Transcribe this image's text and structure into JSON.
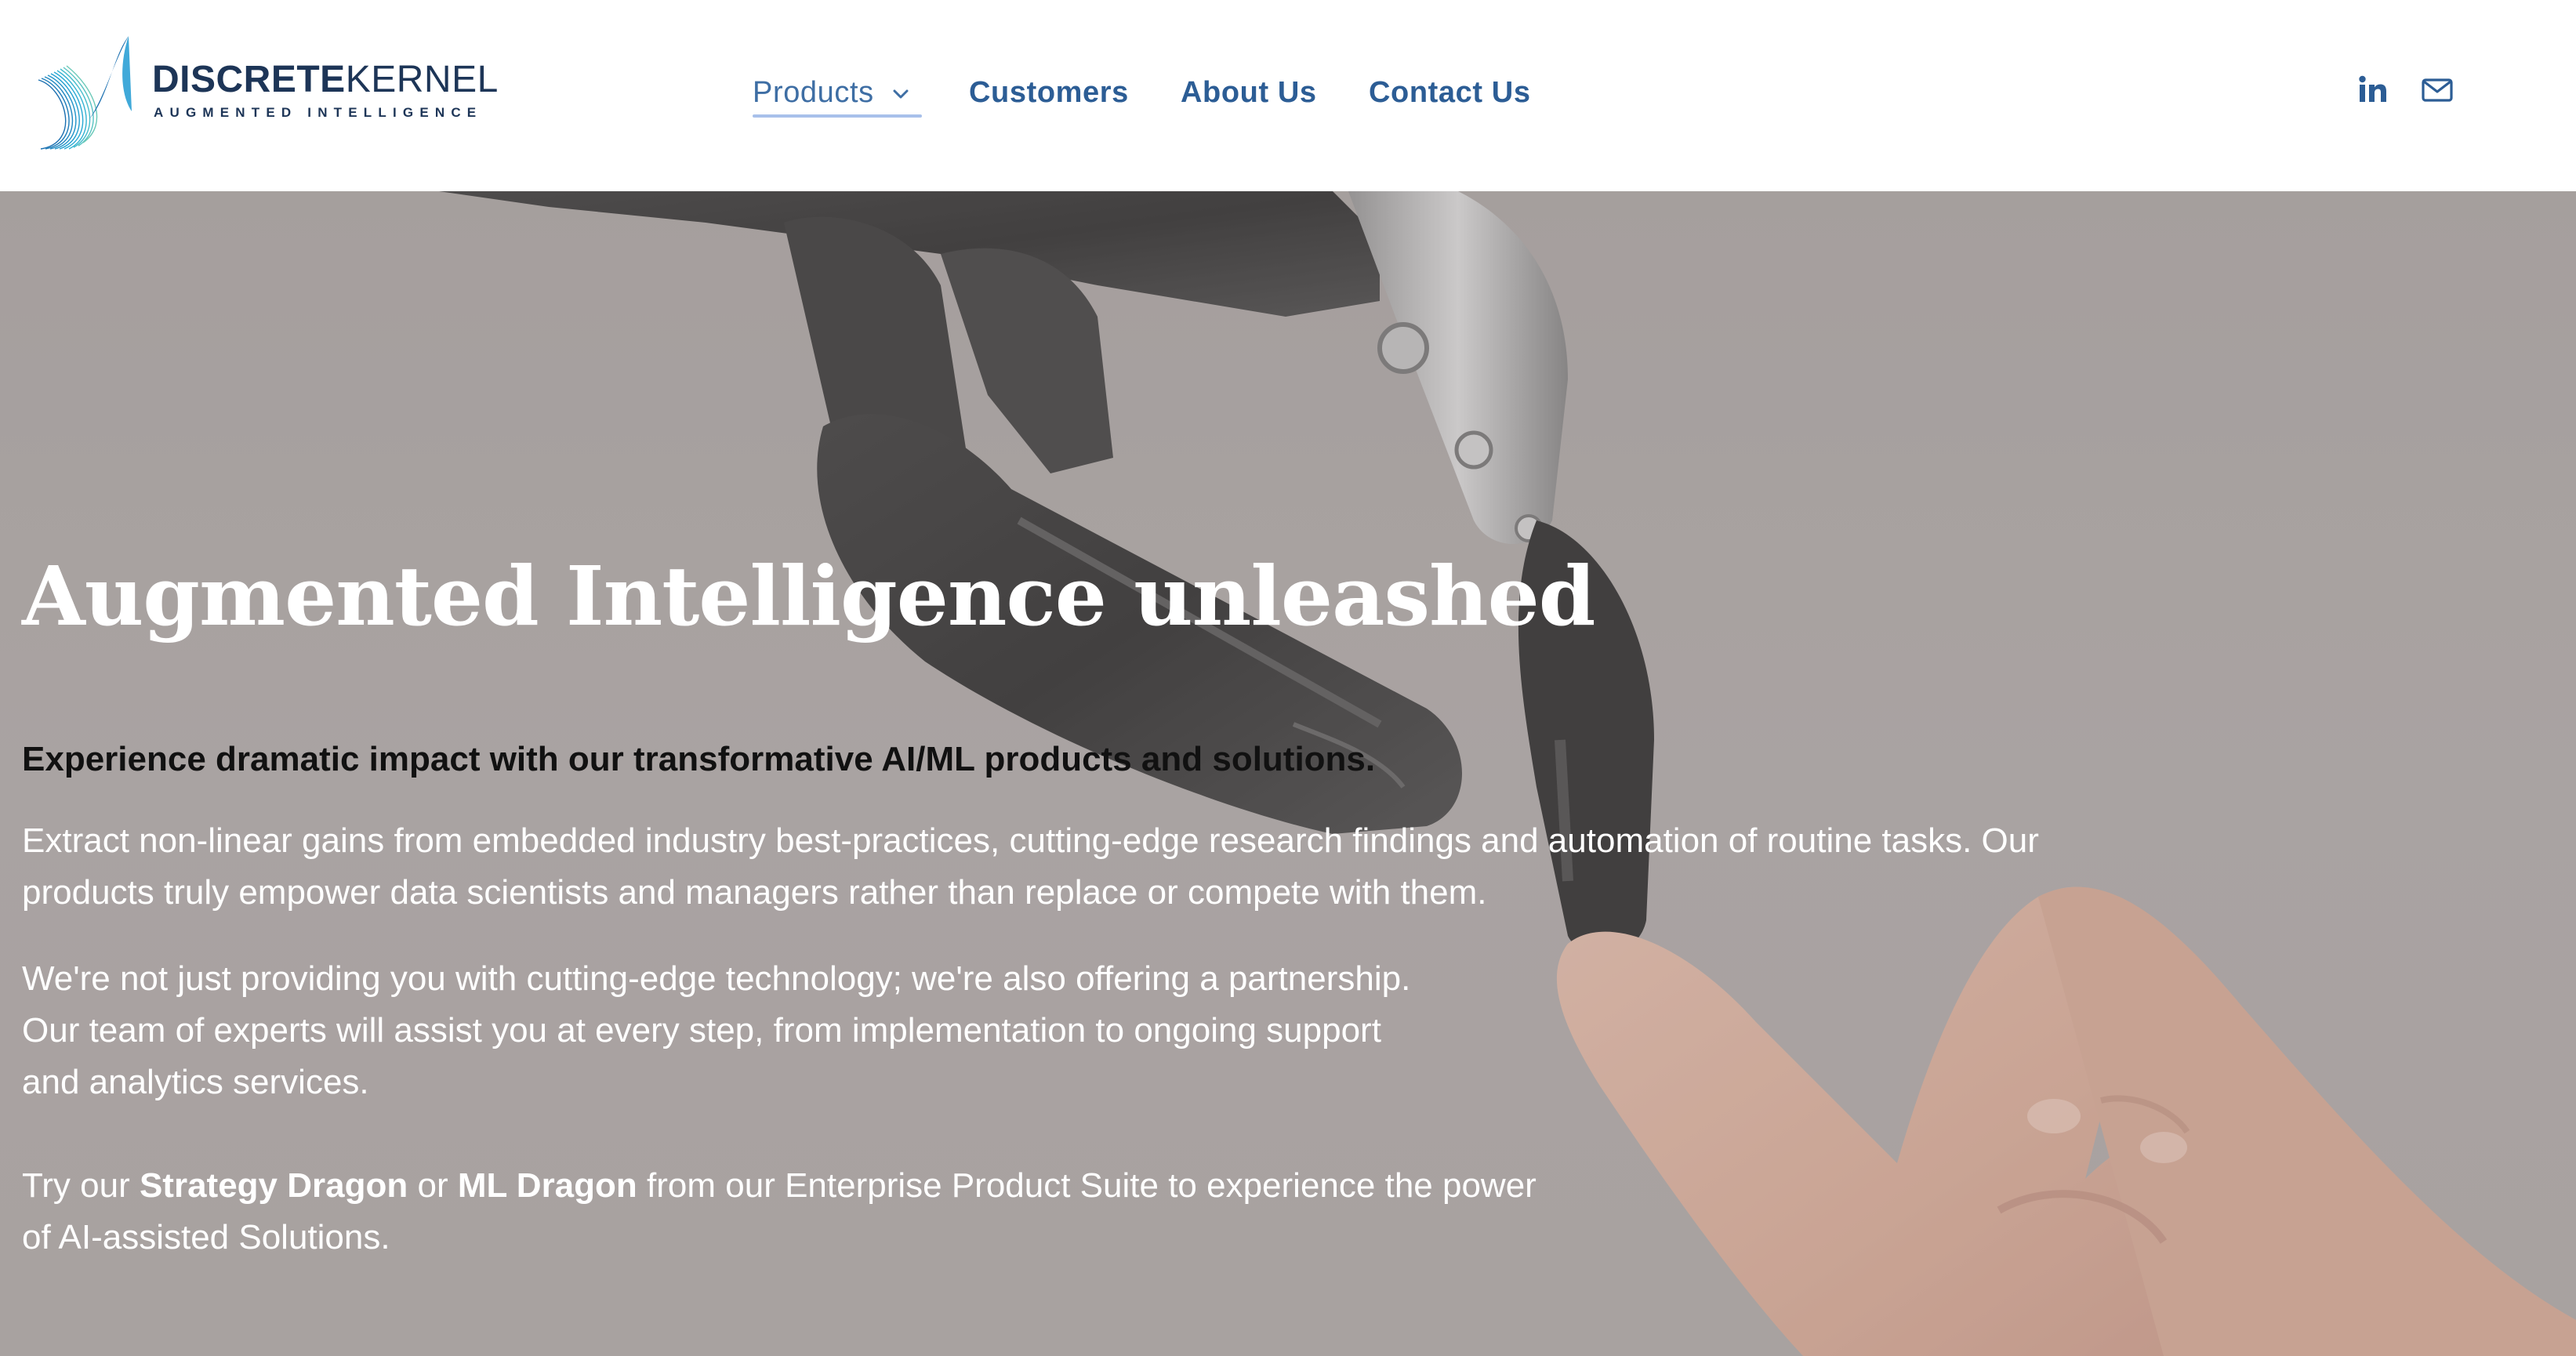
{
  "brand": {
    "name_bold": "DISCRETE",
    "name_light": "KERNEL",
    "tagline": "AUGMENTED INTELLIGENCE",
    "logo_icon": "wave-logo-icon",
    "color": "#1d3557",
    "accent": "#1a9bd0"
  },
  "nav": {
    "products": "Products",
    "products_icon": "chevron-down-icon",
    "customers": "Customers",
    "about": "About Us",
    "contact": "Contact Us",
    "link_color": "#2c5d95",
    "active_underline": "#a8c0ea"
  },
  "social": {
    "linkedin_icon": "linkedin-icon",
    "mail_icon": "mail-icon"
  },
  "hero": {
    "background_image": "robot-hand-touching-human-finger",
    "title": "Augmented Intelligence unleashed",
    "lead": "Experience dramatic impact with our transformative AI/ML products and solutions.",
    "paragraph1": "Extract non-linear gains from embedded industry best-practices, cutting-edge research findings and automation of routine tasks. Our products truly empower data scientists and managers rather than replace or compete with them.",
    "paragraph2_line1": "We're not just providing you with cutting-edge technology; we're also offering a partnership.",
    "paragraph2_line2": "Our team of experts will assist you at every step, from implementation to ongoing support",
    "paragraph2_line3": "and analytics services.",
    "paragraph3": {
      "prefix": "Try our ",
      "product1": "Strategy Dragon",
      "middle": " or ",
      "product2": "ML Dragon",
      "suffix_line1": " from our Enterprise Product Suite to experience the power",
      "suffix_line2": "of AI-assisted Solutions."
    }
  }
}
